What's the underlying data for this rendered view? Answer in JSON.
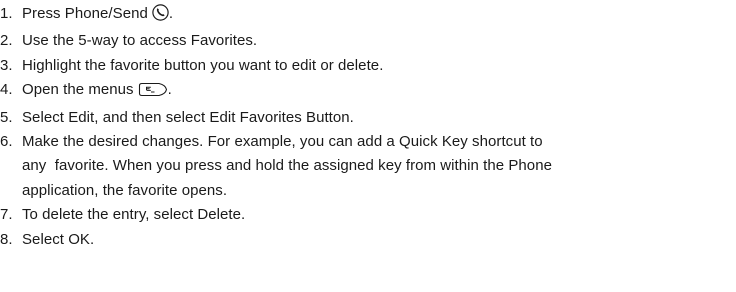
{
  "steps": [
    {
      "number": "1.",
      "text": "Press Phone/Send",
      "suffix": ".",
      "icon": "phone-send-icon"
    },
    {
      "number": "2.",
      "text": "Use the 5-way to access Favorites."
    },
    {
      "number": "3.",
      "text": "Highlight the favorite button you want to edit or delete."
    },
    {
      "number": "4.",
      "text": "Open the menus",
      "suffix": ".",
      "icon": "menu-icon"
    },
    {
      "number": "5.",
      "text": "Select Edit, and then select Edit Favorites Button."
    },
    {
      "number": "6.",
      "lines": [
        "Make the desired changes. For example, you can add a Quick Key shortcut to",
        "any  favorite. When you press and hold the assigned key from within the Phone",
        "application, the favorite opens."
      ]
    },
    {
      "number": "7.",
      "text": "To delete the entry, select Delete."
    },
    {
      "number": "8.",
      "text": "Select OK."
    }
  ]
}
